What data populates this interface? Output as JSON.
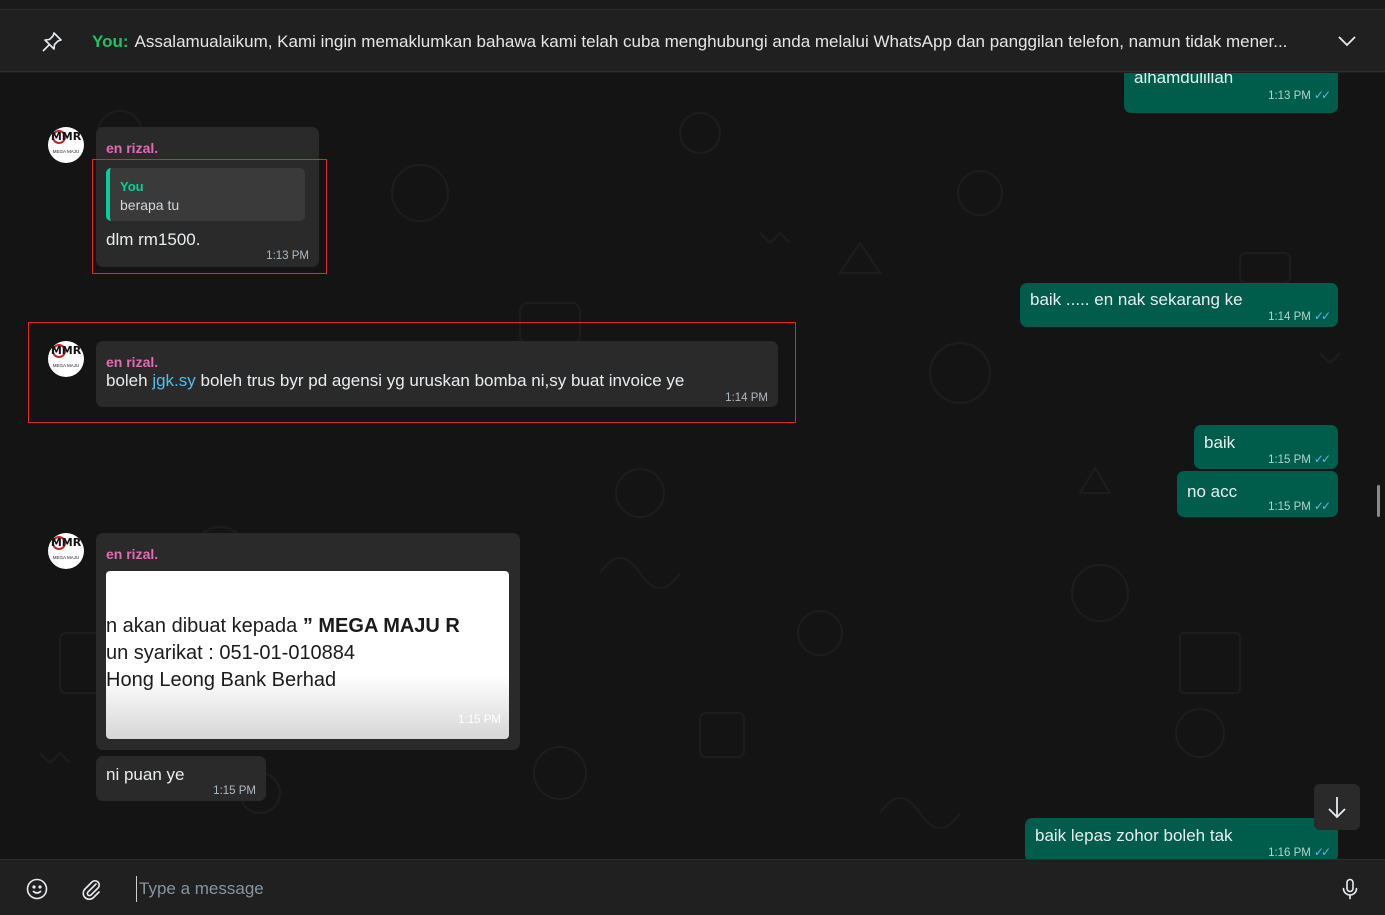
{
  "pinned": {
    "sender": "You:",
    "text": "Assalamualaikum,  Kami ingin memaklumkan bahawa kami telah cuba menghubungi anda melalui WhatsApp dan panggilan telefon, namun tidak mener..."
  },
  "messages": [
    {
      "type": "out",
      "text": "alhamdulillah",
      "time": "1:13 PM"
    },
    {
      "type": "in",
      "sender": "en rizal.",
      "quote_author": "You",
      "quote_text": "berapa tu",
      "text": "dlm rm1500.",
      "time": "1:13 PM"
    },
    {
      "type": "out",
      "text": "baik ..... en nak sekarang ke",
      "time": "1:14 PM"
    },
    {
      "type": "in",
      "sender": "en rizal.",
      "text_before": "boleh ",
      "link": "jgk.sy",
      "text_after": " boleh trus byr pd agensi yg uruskan bomba ni,sy buat invoice ye",
      "time": "1:14 PM"
    },
    {
      "type": "out",
      "text": "baik",
      "time": "1:15 PM"
    },
    {
      "type": "out",
      "text": "no acc",
      "time": "1:15 PM"
    },
    {
      "type": "in",
      "sender": "en rizal.",
      "image": {
        "line1": "n akan dibuat kepada ",
        "line1_bold": "” MEGA MAJU  R",
        "line2": "un syarikat : 051-01-010884",
        "line3": "Hong Leong Bank Berhad"
      },
      "time": "1:15 PM"
    },
    {
      "type": "in",
      "text": "ni puan ye",
      "time": "1:15 PM"
    },
    {
      "type": "out",
      "text": "baik lepas zohor boleh tak",
      "time": "1:16 PM"
    }
  ],
  "avatar": {
    "logo": "MMR",
    "sub": "MEGA MAJU"
  },
  "composer": {
    "placeholder": "Type a message"
  },
  "icons": {
    "pin": "pin-icon",
    "chevron": "chevron-down-icon",
    "emoji": "emoji-icon",
    "attach": "paperclip-icon",
    "mic": "microphone-icon",
    "scroll": "arrow-down-icon",
    "read": "double-check-icon"
  },
  "colors": {
    "outgoing": "#005c4b",
    "incoming": "#2a2a2a",
    "sender_name": "#e26ab6",
    "quote_accent": "#06cf9c",
    "link": "#53bdeb",
    "highlight_box": "#e0282e"
  }
}
